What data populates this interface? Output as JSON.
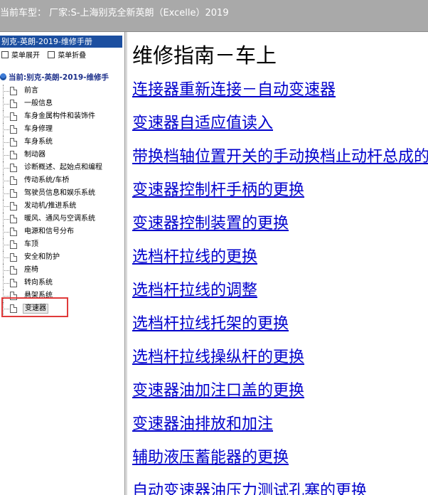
{
  "header": {
    "title": "当前车型： 厂家:S-上海别克全新英朗（Excelle）2019"
  },
  "sidebar": {
    "panel_title": "别克-英朗-2019-维修手册",
    "expand_label": "菜单展开",
    "collapse_label": "菜单折叠",
    "root_label": "当前:别克-英朗-2019-维修手",
    "items": [
      {
        "label": "前言"
      },
      {
        "label": "一般信息"
      },
      {
        "label": "车身金属构件和装饰件"
      },
      {
        "label": "车身修理"
      },
      {
        "label": "车身系统"
      },
      {
        "label": "制动器"
      },
      {
        "label": "诊断概述、起始点和编程"
      },
      {
        "label": "传动系统/车桥"
      },
      {
        "label": "驾驶员信息和娱乐系统"
      },
      {
        "label": "发动机/推进系统"
      },
      {
        "label": "暖风、通风与空调系统"
      },
      {
        "label": "电源和信号分布"
      },
      {
        "label": "车顶"
      },
      {
        "label": "安全和防护"
      },
      {
        "label": "座椅"
      },
      {
        "label": "转向系统"
      },
      {
        "label": "悬架系统"
      },
      {
        "label": "变速器"
      }
    ],
    "selected_index": 17
  },
  "content": {
    "title": "维修指南－车上",
    "links": [
      {
        "label": "连接器重新连接－自动变速器"
      },
      {
        "label": "变速器自适应值读入"
      },
      {
        "label": "带换档轴位置开关的手动换档止动杆总成的更换"
      },
      {
        "label": "变速器控制杆手柄的更换"
      },
      {
        "label": "变速器控制装置的更换"
      },
      {
        "label": "选档杆拉线的更换"
      },
      {
        "label": "选档杆拉线的调整"
      },
      {
        "label": "选档杆拉线托架的更换"
      },
      {
        "label": "选档杆拉线操纵杆的更换"
      },
      {
        "label": "变速器油加注口盖的更换"
      },
      {
        "label": "变速器油排放和加注"
      },
      {
        "label": "辅助液压蓄能器的更换"
      },
      {
        "label": "自动变速器油压力测试孔塞的更换"
      }
    ]
  },
  "colors": {
    "topbar": "#a9a9a9",
    "sidebar_header": "#1c4fa0",
    "link": "#0000cc",
    "highlight": "#e03a3a"
  }
}
